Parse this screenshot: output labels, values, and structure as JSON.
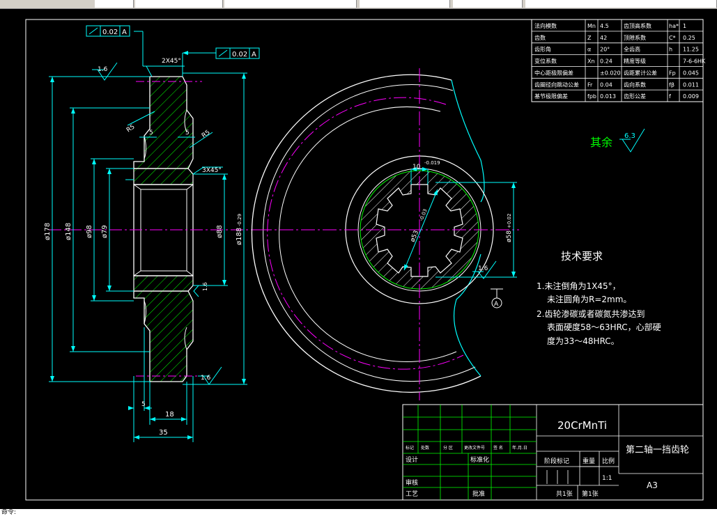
{
  "window": {
    "tabs": [
      "",
      "",
      "",
      "",
      ""
    ],
    "status_text": "命令:"
  },
  "drawing": {
    "colors": {
      "background": "#000000",
      "outline": "#ffffff",
      "dimension": "#00ffff",
      "hatch": "#00ff00",
      "centerline": "#ff00ff",
      "text_yellow": "#ffff00",
      "text_green": "#00ff00"
    },
    "gear_params": [
      {
        "name": "法向模数",
        "sym": "Mn",
        "val": "4.5",
        "name2": "齿顶高系数",
        "sym2": "ha*",
        "val2": "1"
      },
      {
        "name": "齿数",
        "sym": "Z",
        "val": "42",
        "name2": "顶隙系数",
        "sym2": "C*",
        "val2": "0.25"
      },
      {
        "name": "齿形角",
        "sym": "α",
        "val": "20°",
        "name2": "全齿高",
        "sym2": "h",
        "val2": "11.25"
      },
      {
        "name": "变位系数",
        "sym": "Xn",
        "val": "0.24",
        "name2": "精度等级",
        "sym2": "",
        "val2": "7-6-6HK"
      },
      {
        "name": "中心距极限偏差",
        "sym": "",
        "val": "±0.020",
        "name2": "齿距累计公差",
        "sym2": "Fp",
        "val2": "0.045"
      },
      {
        "name": "齿圈径向跳动公差",
        "sym": "Fr",
        "val": "0.04",
        "name2": "齿向系数",
        "sym2": "fβ",
        "val2": "0.011"
      },
      {
        "name": "基节极限偏差",
        "sym": "fpb",
        "val": "0.013",
        "name2": "齿形公差",
        "sym2": "f",
        "val2": "0.009"
      }
    ],
    "remaining_roughness_label": "其余",
    "remaining_roughness_value": "6.3",
    "notes_title": "技术要求",
    "notes": [
      "1.未注倒角为1X45°，",
      "未注圆角为R=2mm。",
      "2.齿轮渗碳或者碳氮共渗达到",
      "表面硬度58～63HRC，心部硬",
      "度为33～48HRC。"
    ],
    "dims": {
      "tol1": "0.02",
      "datum": "A",
      "tol2": "0.02",
      "chamfer_top": "2X45°",
      "chamfer_bore": "3X45°",
      "rough_top": "1.6",
      "rough_right": "1.6",
      "rough_bottom": "1.6",
      "rough_front": "1.6",
      "r5": "R5",
      "r5b": "R5",
      "w5a": "5",
      "w5b": "5",
      "w5c": "5",
      "w18": "18",
      "w35": "35",
      "d178": "ø178",
      "d148": "ø148",
      "d98": "ø98",
      "d79": "ø79",
      "d88": "ø88",
      "d188": "ø188",
      "d188_tol": "-0.29",
      "spline_w": "10",
      "spline_w_tol": "-0.019",
      "d53": "ø53",
      "d53_tol": "-0.03",
      "d58": "ø58",
      "d58_tol": "+0.02",
      "section_label": "A"
    },
    "title_block": {
      "material": "20CrMnTi",
      "part_name": "第二轴一挡齿轮",
      "sheet_size": "A3",
      "scale": "1:1",
      "row_labels": [
        "标记",
        "处数",
        "分 区",
        "更改文件号",
        "签 名",
        "年.月.日"
      ],
      "design": "设计",
      "standard": "标准化",
      "stage": "阶段标记",
      "weight": "重量",
      "scale_label": "比例",
      "check": "审核",
      "process": "工艺",
      "approve": "批准",
      "sheets": "共1张",
      "sheet_no": "第1张"
    }
  }
}
